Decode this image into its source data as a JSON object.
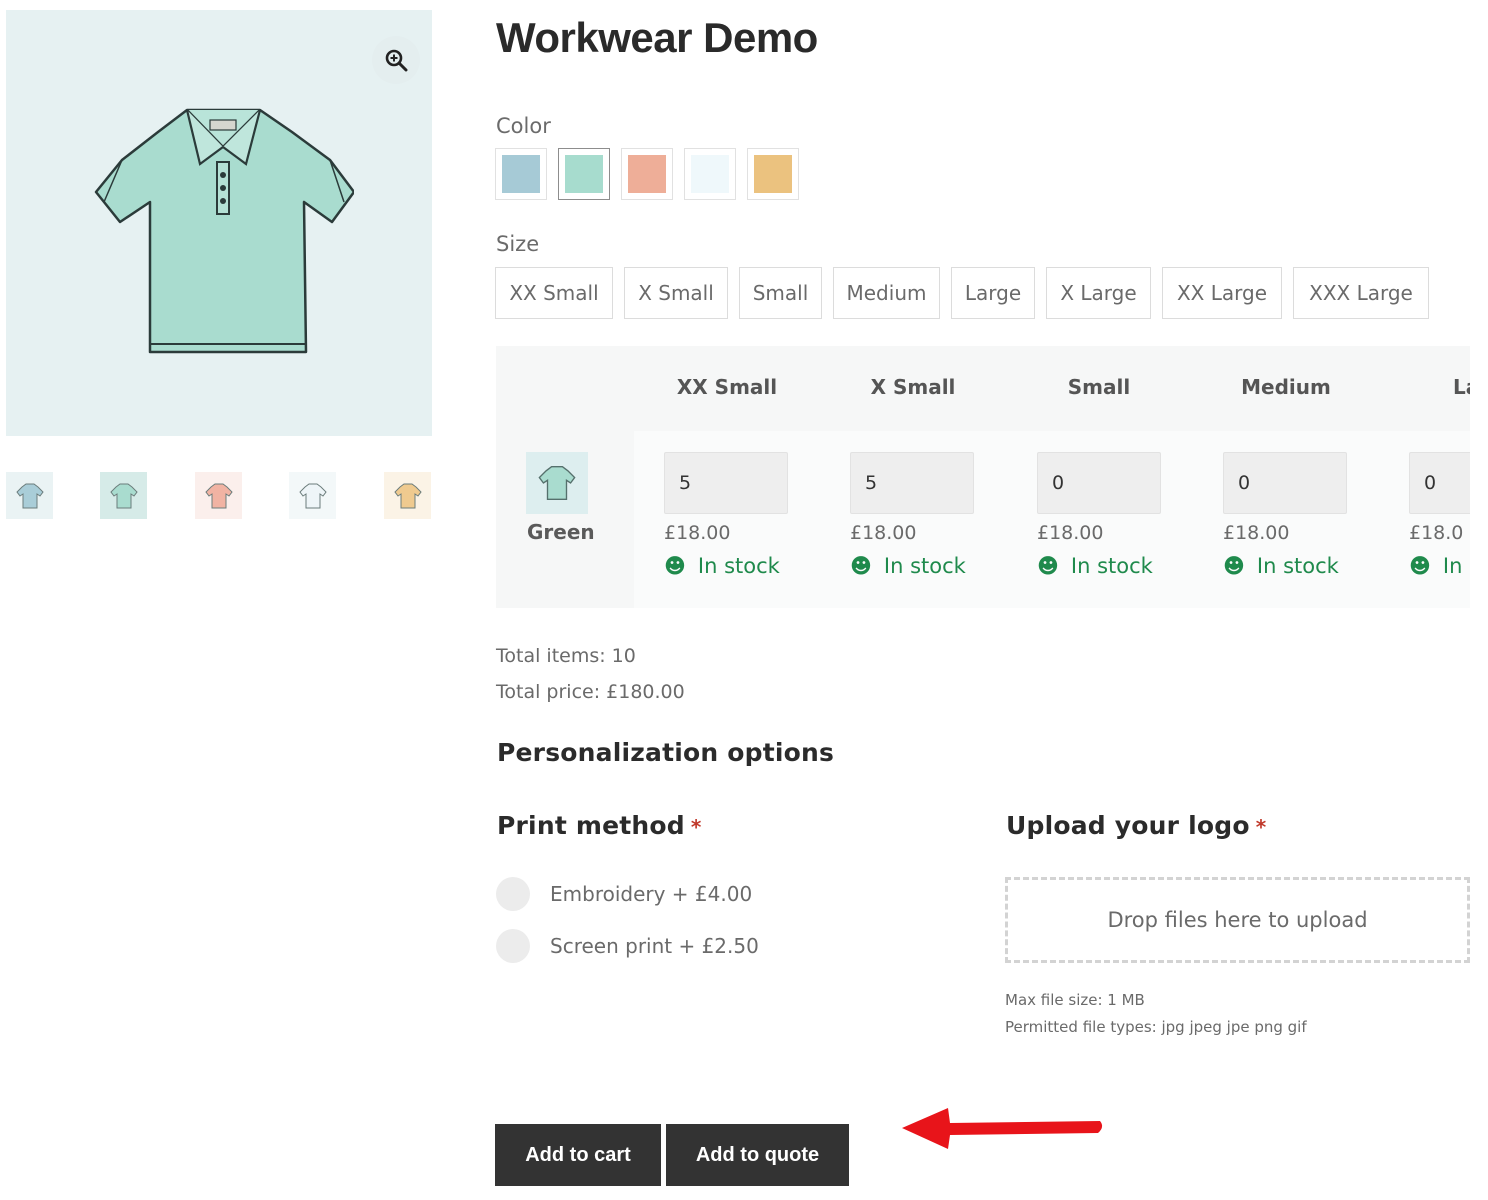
{
  "product": {
    "title": "Workwear Demo",
    "gallery": {
      "zoom_icon": "zoom-in-icon",
      "thumbnail_colors": [
        "#a9cdd8",
        "#a9dccf",
        "#f1b3a3",
        "#eef5f8",
        "#efca8f"
      ]
    }
  },
  "color": {
    "label": "Color",
    "options": [
      {
        "name": "Blue",
        "hex": "#a6cad6"
      },
      {
        "name": "Green",
        "hex": "#a7dcce",
        "selected": true
      },
      {
        "name": "Coral",
        "hex": "#eeae98"
      },
      {
        "name": "White",
        "hex": "#eff8fb"
      },
      {
        "name": "Yellow",
        "hex": "#ebc27f"
      }
    ]
  },
  "size": {
    "label": "Size",
    "options": [
      "XX Small",
      "X Small",
      "Small",
      "Medium",
      "Large",
      "X Large",
      "XX Large",
      "XXX Large"
    ]
  },
  "grid": {
    "columns": [
      "XX Small",
      "X Small",
      "Small",
      "Medium",
      "La"
    ],
    "row": {
      "label": "Green",
      "cells": [
        {
          "qty": "5",
          "price": "£18.00",
          "stock": "In stock"
        },
        {
          "qty": "5",
          "price": "£18.00",
          "stock": "In stock"
        },
        {
          "qty": "0",
          "price": "£18.00",
          "stock": "In stock"
        },
        {
          "qty": "0",
          "price": "£18.00",
          "stock": "In stock"
        },
        {
          "qty": "0",
          "price": "£18.0",
          "stock": "In "
        }
      ]
    },
    "stock_color": "#1f8a4c"
  },
  "totals": {
    "items": "Total items: 10",
    "price": "Total price: £180.00"
  },
  "personalization": {
    "heading": "Personalization options",
    "print_method": {
      "label": "Print method",
      "required_mark": "*",
      "options": [
        "Embroidery + £4.00",
        "Screen print + £2.50"
      ]
    },
    "upload": {
      "label": "Upload your logo",
      "required_mark": "*",
      "dropzone_text": "Drop files here to upload",
      "max_size": "Max file size: 1 MB",
      "permitted_types": "Permitted file types: jpg jpeg jpe png gif"
    }
  },
  "actions": {
    "add_to_cart": "Add to cart",
    "add_to_quote": "Add to quote",
    "arrow_color": "#e8141a"
  }
}
